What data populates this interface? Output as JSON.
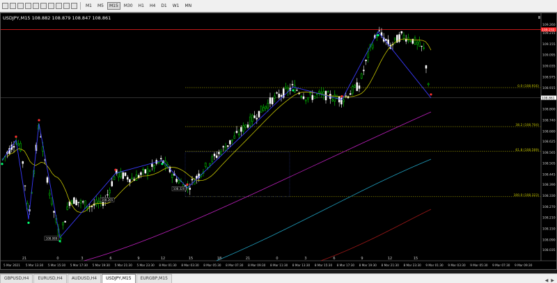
{
  "toolbar": {
    "timeframes": [
      "M1",
      "M5",
      "M15",
      "M30",
      "H1",
      "H4",
      "D1",
      "W1",
      "MN"
    ],
    "active_timeframe": "M15"
  },
  "chart": {
    "symbol_title": "USDJPY,M15  108.882 108.879 108.847 108.861",
    "current_price": "108.861",
    "high_price_label": "109.232",
    "price_axis": [
      "109.260",
      "109.215",
      "109.155",
      "109.095",
      "109.035",
      "108.975",
      "108.915",
      "108.861",
      "108.800",
      "108.740",
      "108.680",
      "108.625",
      "108.565",
      "108.505",
      "108.445",
      "108.390",
      "108.330",
      "108.270",
      "108.210",
      "108.150",
      "108.090",
      "108.035"
    ],
    "fib_labels": [
      "0.0 (108.916)",
      "38.2 (108.704)",
      "61.8 (108.569)",
      "100.0 (108.323)"
    ],
    "time_axis": [
      "5 Mar 2021",
      "5 Mar 13:30",
      "5 Mar 15:30",
      "5 Mar 17:30",
      "5 Mar 19:30",
      "5 Mar 21:30",
      "5 Mar 23:30",
      "8 Mar 01:30",
      "8 Mar 03:30",
      "8 Mar 05:30",
      "8 Mar 07:30",
      "8 Mar 09:30",
      "8 Mar 11:30",
      "8 Mar 13:30",
      "8 Mar 15:30",
      "8 Mar 17:30",
      "8 Mar 19:30",
      "8 Mar 21:30",
      "8 Mar 23:30",
      "9 Mar 01:30",
      "9 Mar 03:30",
      "9 Mar 05:30",
      "9 Mar 07:30",
      "9 Mar 09:30"
    ],
    "period_markers": [
      "21",
      "0",
      "3",
      "6",
      "9",
      "12",
      "15",
      "18",
      "21",
      "0",
      "3",
      "6",
      "9",
      "12",
      "15"
    ],
    "low_labels": [
      "108.089",
      "108.265",
      "108.320"
    ],
    "colors": {
      "bull": "#00e000",
      "bear": "#ffffff",
      "zigzag": "#3a3aff",
      "ma_fast": "#c8c800",
      "ma_magenta": "#c020c0",
      "ma_cyan": "#20a0c0",
      "ma_red": "#a01818",
      "fib": "#c8c800",
      "resistance": "#ff2020"
    }
  },
  "tabs": [
    "GBPUSD,H4",
    "EURUSD,H4",
    "AUDUSD,H4",
    "USDJPY,M15",
    "EURGBP,M15"
  ],
  "active_tab": "USDJPY,M15",
  "nav": {
    "left": "◀",
    "right": "▶"
  }
}
